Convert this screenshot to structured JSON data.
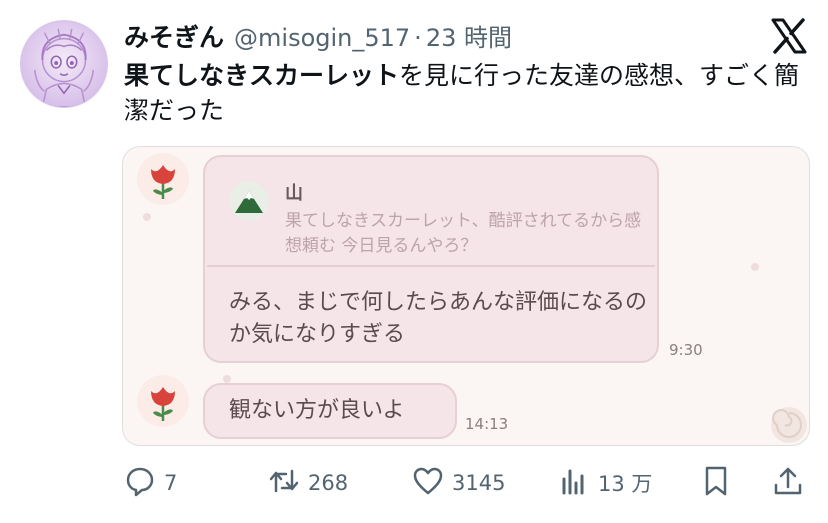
{
  "post": {
    "display_name": "みそぎん",
    "handle": "@misogin_517",
    "separator": "·",
    "time": "23 時間",
    "text_bold": "果てしなきスカーレット",
    "text_rest": "を見に行った友達の感想、すごく簡潔だった"
  },
  "chat": {
    "quote": {
      "name": "山",
      "text": "果てしなきスカーレット、酷評されてるから感想頼む 今日見るんやろ？"
    },
    "message_1": {
      "text": "みる、まじで何したらあんな評価になるのか気になりすぎる",
      "time": "9:30"
    },
    "message_2": {
      "text": "観ない方が良いよ",
      "time": "14:13"
    }
  },
  "actions": {
    "replies": "7",
    "reposts": "268",
    "likes": "3145",
    "views": "13 万"
  },
  "icons": {
    "reply": "reply-icon",
    "repost": "repost-icon",
    "like": "heart-icon",
    "views": "views-icon",
    "bookmark": "bookmark-icon",
    "share": "share-icon",
    "brand": "x-logo-icon"
  },
  "colors": {
    "text": "#0f1419",
    "secondary": "#536471",
    "bubble": "#f5e4e8",
    "bubble_border": "#e6cfd6",
    "flower_red": "#d8433b"
  }
}
